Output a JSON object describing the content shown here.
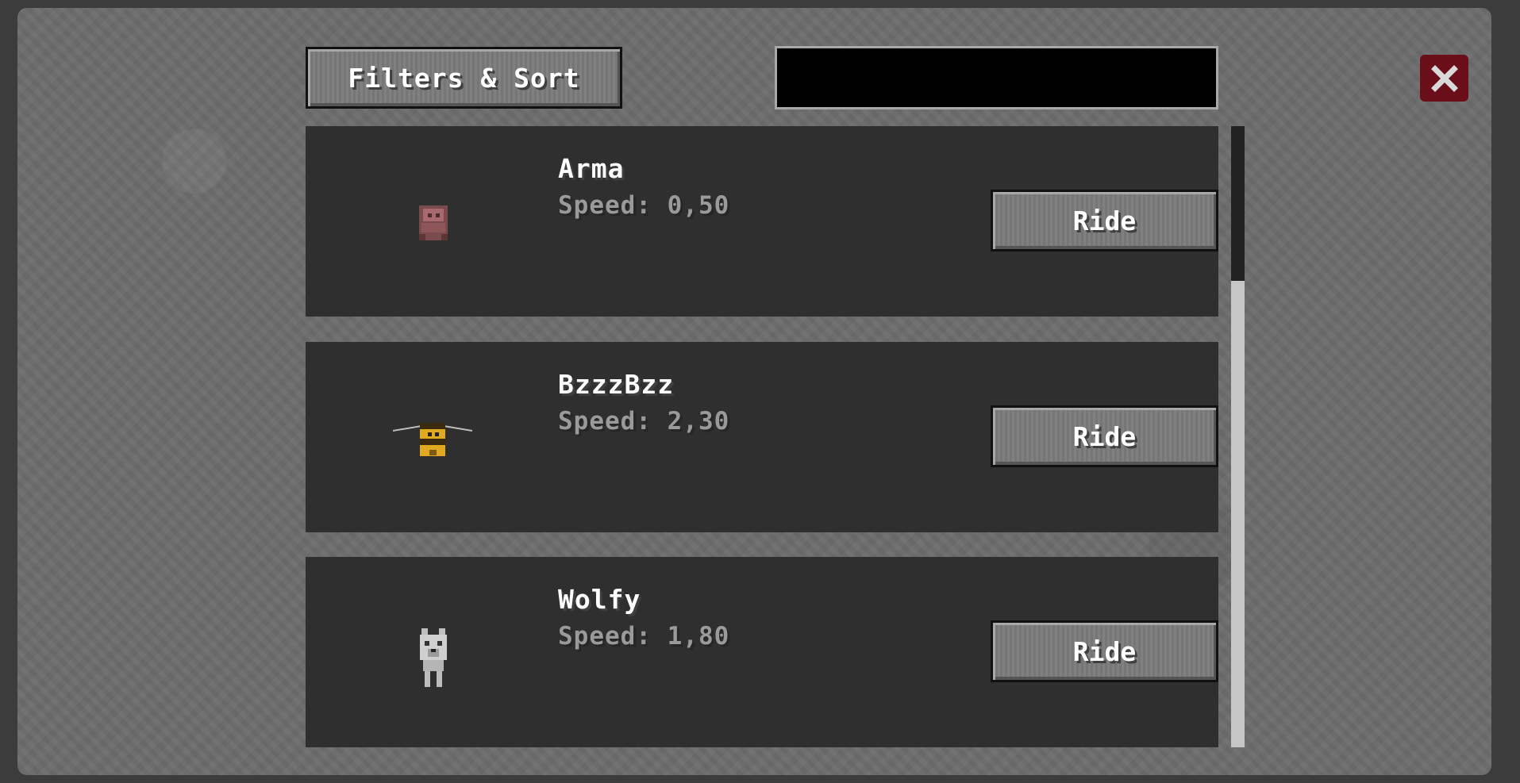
{
  "toolbar": {
    "filters_label": "Filters & Sort",
    "search_value": "",
    "search_placeholder": ""
  },
  "entries": [
    {
      "name": "Arma",
      "speed": "Speed: 0,50",
      "ride_label": "Ride",
      "icon": "pig-mob-icon"
    },
    {
      "name": "BzzzBzz",
      "speed": "Speed: 2,30",
      "ride_label": "Ride",
      "icon": "bee-mob-icon"
    },
    {
      "name": "Wolfy",
      "speed": "Speed: 1,80",
      "ride_label": "Ride",
      "icon": "wolf-mob-icon"
    }
  ],
  "scrollbar": {
    "position": 0
  },
  "colors": {
    "panel": "#6c6c6c",
    "entry_bg": "#2f2f2f",
    "close_bg": "#6a0f1a",
    "speed_text": "#9a9a9a"
  }
}
